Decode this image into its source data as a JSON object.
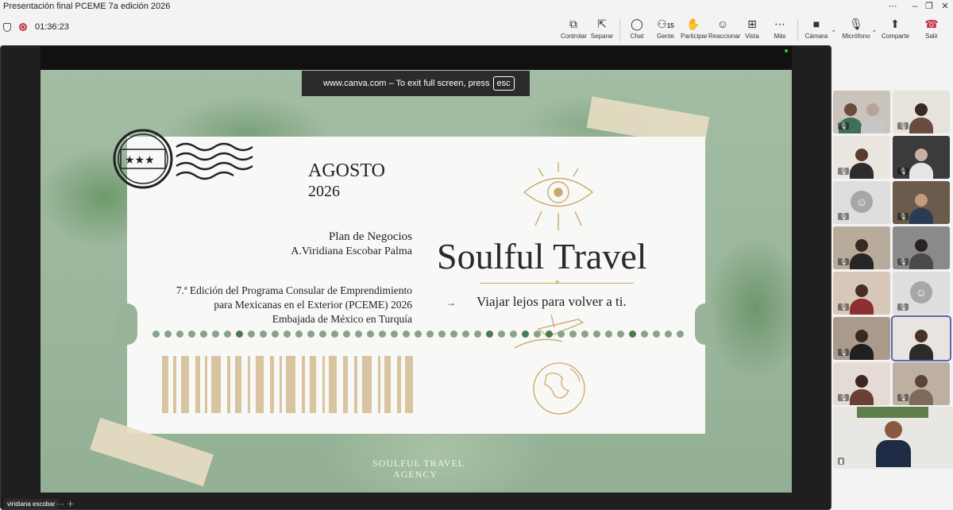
{
  "window": {
    "title": "Presentación final PCEME 7a edición 2026"
  },
  "meeting": {
    "elapsed": "01:36:23",
    "people_count": "15"
  },
  "toolbar": {
    "control": "Controlar",
    "popout": "Separar",
    "chat": "Chat",
    "people": "Gente",
    "raise": "Participar",
    "react": "Reaccionar",
    "view": "Vista",
    "more": "Más",
    "camera": "Cámara",
    "mic": "Micrófono",
    "share": "Comparte",
    "leave": "Salir"
  },
  "fullscreen_banner": {
    "text": "www.canva.com – To exit full screen, press",
    "key": "esc"
  },
  "slide": {
    "month": "AGOSTO",
    "year": "2026",
    "plan": "Plan de Negocios",
    "author": "A.Viridiana Escobar Palma",
    "edition_1": "7.ª Edición del Programa Consular de Emprendimiento",
    "edition_2": "para Mexicanas en el Exterior (PCEME) 2026",
    "edition_3": "Embajada de México en Turquía",
    "brand": "Soulful Travel",
    "tagline": "Viajar lejos para volver a ti.",
    "agency_1": "SOULFUL TRAVEL",
    "agency_2": "AGENCY"
  },
  "presenter": {
    "name": "viridiana escobar"
  },
  "colors": {
    "accent": "#6264a7",
    "leave": "#c4314b",
    "slide_bg": "#9cb79f",
    "tape": "#e6dcc2"
  }
}
